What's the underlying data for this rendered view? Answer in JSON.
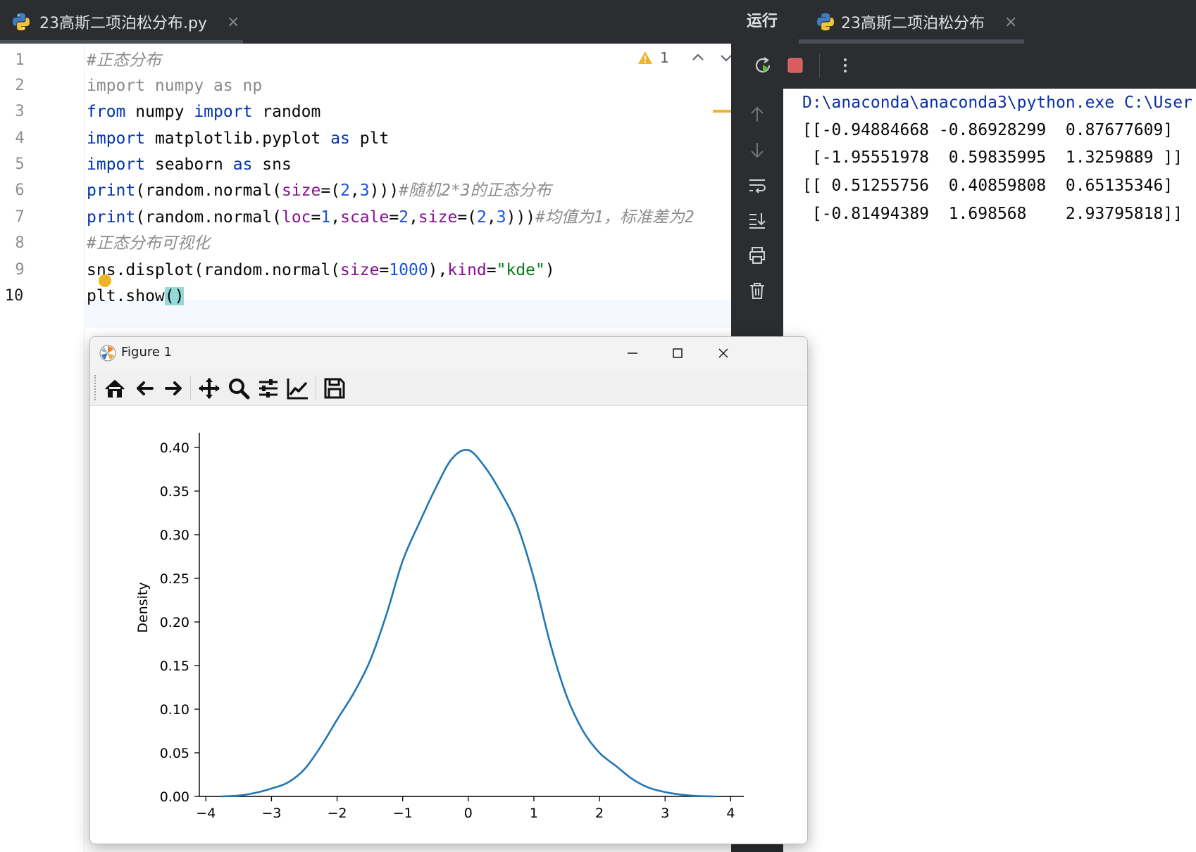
{
  "editor_tab": {
    "title": "23高斯二项泊松分布.py",
    "close": "×"
  },
  "inspection": {
    "warning_count": "1"
  },
  "lines": {
    "numbers": [
      "1",
      "2",
      "3",
      "4",
      "5",
      "6",
      "7",
      "8",
      "9",
      "10"
    ],
    "l1": "#正态分布",
    "l2": "import numpy as np",
    "l3": {
      "kw1": "from",
      "t1": " numpy ",
      "kw2": "import",
      "t2": " random"
    },
    "l4": {
      "kw1": "import",
      "t1": " matplotlib.pyplot ",
      "kw2": "as",
      "t2": " plt"
    },
    "l5": {
      "kw1": "import",
      "t1": " seaborn ",
      "kw2": "as",
      "t2": " sns"
    },
    "l6": {
      "fn": "print",
      "a": "(random.normal(",
      "p": "size",
      "b": "=(",
      "n1": "2",
      "c": ",",
      "n2": "3",
      "d": ")))",
      "cm": "#随机2*3的正态分布"
    },
    "l7": {
      "fn": "print",
      "a": "(random.normal(",
      "p1": "loc",
      "e1": "=",
      "n1": "1",
      "c1": ",",
      "p2": "scale",
      "e2": "=",
      "n2": "2",
      "c2": ",",
      "p3": "size",
      "e3": "=(",
      "n3": "2",
      "c3": ",",
      "n4": "3",
      "d": ")))",
      "cm": "#均值为1，标准差为2"
    },
    "l8": "#正态分布可视化",
    "l9": {
      "a": "sns.displot(random.normal(",
      "p1": "size",
      "e1": "=",
      "n1": "1000",
      "b": "),",
      "p2": "kind",
      "e2": "=",
      "s": "\"kde\"",
      "c": ")"
    },
    "l10": {
      "a": "plt.show",
      "b": "()"
    }
  },
  "run_panel": {
    "label": "运行",
    "tab_title": "23高斯二项泊松分布",
    "close": "×",
    "console": [
      "D:\\anaconda\\anaconda3\\python.exe C:\\User",
      "[[-0.94884668 -0.86928299  0.87677609]",
      " [-1.95551978  0.59835995  1.3259889 ]]",
      "[[ 0.51255756  0.40859808  0.65135346]",
      " [-0.81494389  1.698568    2.93795818]]"
    ]
  },
  "figure_window": {
    "title": "Figure 1",
    "toolbar": [
      "home-icon",
      "back-icon",
      "forward-icon",
      "pan-icon",
      "zoom-icon",
      "configure-subplots-icon",
      "edit-axis-icon",
      "save-icon"
    ]
  },
  "chart_data": {
    "type": "line",
    "ylabel": "Density",
    "xlabel": "",
    "xlim": [
      -4.1,
      4.2
    ],
    "ylim": [
      0,
      0.4
    ],
    "xticks": [
      -4,
      -3,
      -2,
      -1,
      0,
      1,
      2,
      3,
      4
    ],
    "xtick_labels": [
      "−4",
      "−3",
      "−2",
      "−1",
      "0",
      "1",
      "2",
      "3",
      "4"
    ],
    "yticks": [
      0,
      0.05,
      0.1,
      0.15,
      0.2,
      0.25,
      0.3,
      0.35,
      0.4
    ],
    "ytick_labels": [
      "0.00",
      "0.05",
      "0.10",
      "0.15",
      "0.20",
      "0.25",
      "0.30",
      "0.35",
      "0.40"
    ],
    "series": [
      {
        "color": "#1f77b4",
        "x": [
          -3.75,
          -3.5,
          -3.25,
          -3.0,
          -2.75,
          -2.5,
          -2.25,
          -2.0,
          -1.75,
          -1.5,
          -1.25,
          -1.0,
          -0.75,
          -0.5,
          -0.25,
          0.0,
          0.25,
          0.5,
          0.75,
          1.0,
          1.25,
          1.5,
          1.75,
          2.0,
          2.25,
          2.5,
          2.75,
          3.0,
          3.25,
          3.5,
          3.75
        ],
        "y": [
          0.0,
          0.001,
          0.004,
          0.009,
          0.016,
          0.031,
          0.057,
          0.088,
          0.118,
          0.155,
          0.208,
          0.27,
          0.313,
          0.353,
          0.387,
          0.397,
          0.378,
          0.348,
          0.31,
          0.25,
          0.175,
          0.115,
          0.075,
          0.05,
          0.035,
          0.02,
          0.01,
          0.005,
          0.002,
          0.0005,
          0.0
        ]
      }
    ]
  }
}
